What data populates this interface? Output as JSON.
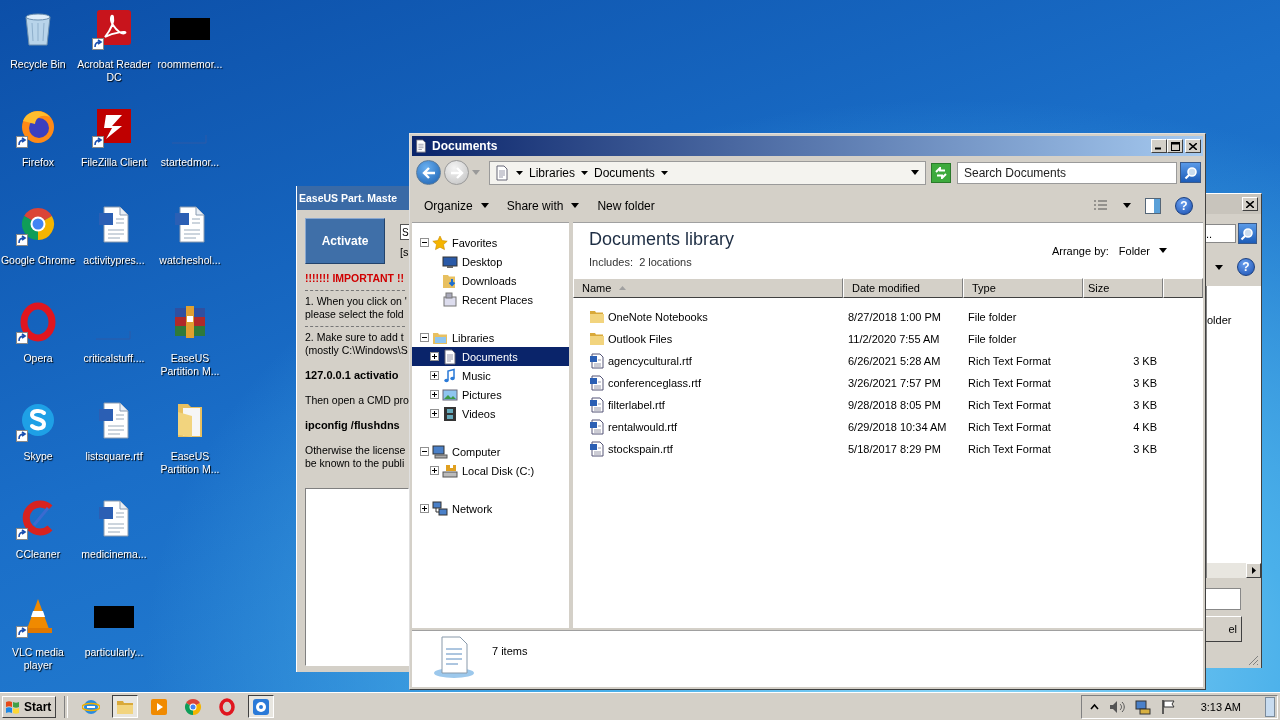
{
  "desktop_icons": [
    {
      "label": "Recycle Bin",
      "kind": "recycle",
      "shortcut": false
    },
    {
      "label": "Firefox",
      "kind": "firefox",
      "shortcut": true
    },
    {
      "label": "Google Chrome",
      "kind": "chrome",
      "shortcut": true
    },
    {
      "label": "Opera",
      "kind": "opera",
      "shortcut": true
    },
    {
      "label": "Skype",
      "kind": "skype",
      "shortcut": true
    },
    {
      "label": "CCleaner",
      "kind": "ccleaner",
      "shortcut": true
    },
    {
      "label": "VLC media player",
      "kind": "vlc",
      "shortcut": true
    },
    {
      "label": "Acrobat Reader DC",
      "kind": "pdf",
      "shortcut": true
    },
    {
      "label": "FileZilla Client",
      "kind": "filezilla",
      "shortcut": true
    },
    {
      "label": "activitypres...",
      "kind": "word",
      "shortcut": false
    },
    {
      "label": "criticalstuff....",
      "kind": "blank",
      "shortcut": false
    },
    {
      "label": "listsquare.rtf",
      "kind": "word",
      "shortcut": false
    },
    {
      "label": "medicinema...",
      "kind": "word",
      "shortcut": false
    },
    {
      "label": "particularly...",
      "kind": "redacted",
      "shortcut": false
    },
    {
      "label": "roommemor...",
      "kind": "redacted",
      "shortcut": false
    },
    {
      "label": "startedmor...",
      "kind": "blank",
      "shortcut": false
    },
    {
      "label": "watcheshol...",
      "kind": "word",
      "shortcut": false
    },
    {
      "label": "EaseUS Partition M...",
      "kind": "archive",
      "shortcut": false
    },
    {
      "label": "EaseUS Partition M...",
      "kind": "folder",
      "shortcut": false
    }
  ],
  "easeus_window": {
    "title": "EaseUS Part. Maste",
    "activate_button": "Activate",
    "key_field": "S",
    "key_hint": "[s",
    "lines": [
      {
        "kind": "warning",
        "text": "!!!!!!! IMPORTANT !!"
      },
      {
        "kind": "rule"
      },
      {
        "kind": "plain",
        "text": "1. When you click on '"
      },
      {
        "kind": "plain",
        "text": "please select the fold"
      },
      {
        "kind": "rule"
      },
      {
        "kind": "plain",
        "text": "2. Make sure to add t"
      },
      {
        "kind": "plain",
        "text": "(mostly C:\\Windows\\S"
      },
      {
        "kind": "bold",
        "text": "127.0.0.1  activatio"
      },
      {
        "kind": "plain",
        "text": "Then open a CMD pro"
      },
      {
        "kind": "bold",
        "text": "ipconfig /flushdns"
      },
      {
        "kind": "plain",
        "text": "Otherwise the license"
      },
      {
        "kind": "plain",
        "text": "be known to the publi"
      }
    ]
  },
  "dialog": {
    "search_value": "..",
    "help": "?",
    "side_text": "older",
    "button": "el"
  },
  "explorer": {
    "title": "Documents",
    "breadcrumb": [
      "Libraries",
      "Documents"
    ],
    "search": {
      "placeholder": "Search Documents"
    },
    "toolbar": [
      {
        "label": "Organize",
        "dropdown": true
      },
      {
        "label": "Share with",
        "dropdown": true
      },
      {
        "label": "New folder",
        "dropdown": false
      }
    ],
    "help": "?",
    "nav": [
      {
        "label": "Favorites",
        "kind": "star",
        "expanded": true,
        "selected": false,
        "children": [
          {
            "label": "Desktop",
            "kind": "desktop",
            "selected": false
          },
          {
            "label": "Downloads",
            "kind": "downloads",
            "selected": false
          },
          {
            "label": "Recent Places",
            "kind": "recent",
            "selected": false
          }
        ]
      },
      {
        "label": "Libraries",
        "kind": "library",
        "expanded": true,
        "selected": false,
        "children": [
          {
            "label": "Documents",
            "kind": "documents",
            "expanded": false,
            "selected": true
          },
          {
            "label": "Music",
            "kind": "music",
            "expanded": false,
            "selected": false
          },
          {
            "label": "Pictures",
            "kind": "pictures",
            "expanded": false,
            "selected": false
          },
          {
            "label": "Videos",
            "kind": "videos",
            "expanded": false,
            "selected": false
          }
        ]
      },
      {
        "label": "Computer",
        "kind": "computer",
        "expanded": true,
        "selected": false,
        "children": [
          {
            "label": "Local Disk (C:)",
            "kind": "disk",
            "expanded": false,
            "selected": false
          }
        ]
      },
      {
        "label": "Network",
        "kind": "network",
        "expanded": false,
        "selected": false
      }
    ],
    "library": {
      "title": "Documents library",
      "includes": "Includes:  2 locations",
      "arrange_label": "Arrange by:",
      "arrange_value": "Folder"
    },
    "columns": [
      {
        "label": "Name",
        "sorted": true
      },
      {
        "label": "Date modified",
        "sorted": false
      },
      {
        "label": "Type",
        "sorted": false
      },
      {
        "label": "Size",
        "sorted": false
      }
    ],
    "files": [
      {
        "name": "OneNote Notebooks",
        "kind": "folder",
        "date": "8/27/2018 1:00 PM",
        "type": "File folder"
      },
      {
        "name": "Outlook Files",
        "kind": "folder",
        "date": "11/2/2020 7:55 AM",
        "type": "File folder"
      },
      {
        "name": "agencycultural.rtf",
        "kind": "rtf",
        "date": "6/26/2021 5:28 AM",
        "type": "Rich Text Format",
        "size": "3 KB"
      },
      {
        "name": "conferenceglass.rtf",
        "kind": "rtf",
        "date": "3/26/2021 7:57 PM",
        "type": "Rich Text Format",
        "size": "3 KB"
      },
      {
        "name": "filterlabel.rtf",
        "kind": "rtf",
        "date": "9/28/2018 8:05 PM",
        "type": "Rich Text Format",
        "size": "3 KB"
      },
      {
        "name": "rentalwould.rtf",
        "kind": "rtf",
        "date": "6/29/2018 10:34 AM",
        "type": "Rich Text Format",
        "size": "4 KB"
      },
      {
        "name": "stockspain.rtf",
        "kind": "rtf",
        "date": "5/18/2017 8:29 PM",
        "type": "Rich Text Format",
        "size": "3 KB"
      }
    ],
    "status": "7 items"
  },
  "taskbar": {
    "start": "Start",
    "apps": [
      {
        "kind": "ie",
        "active": false
      },
      {
        "kind": "explorer",
        "active": true
      },
      {
        "kind": "media",
        "active": false
      },
      {
        "kind": "chrome",
        "active": false
      },
      {
        "kind": "opera",
        "active": false
      },
      {
        "kind": "easeus",
        "active": true
      }
    ],
    "clock": "3:13 AM"
  }
}
